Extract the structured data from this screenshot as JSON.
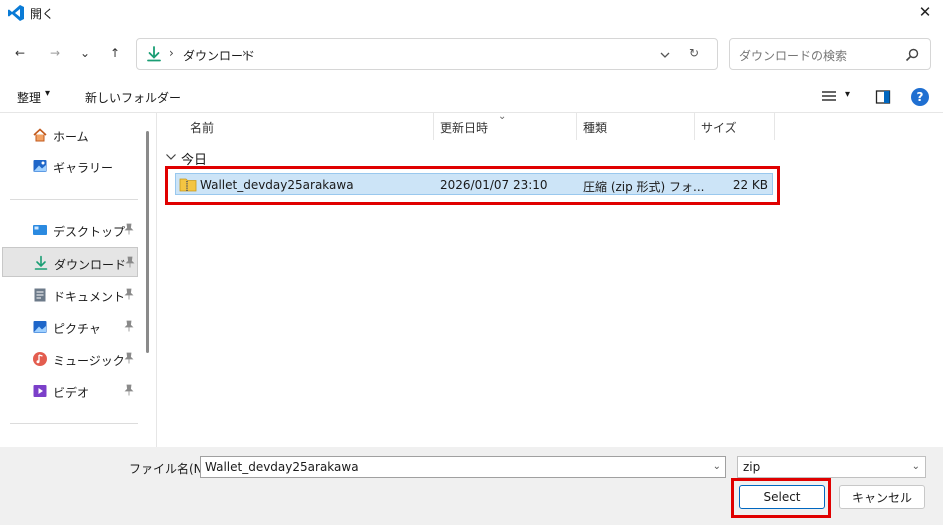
{
  "window": {
    "title": "開く",
    "close_glyph": "✕"
  },
  "navigation": {
    "back_glyph": "←",
    "forward_glyph": "→",
    "recent_glyph": "⌄",
    "up_glyph": "↑",
    "breadcrumb_separator": "›",
    "breadcrumb": [
      "ダウンロード"
    ],
    "refresh_glyph": "↻"
  },
  "search": {
    "placeholder": "ダウンロードの検索"
  },
  "commandbar": {
    "organize_label": "整理",
    "organize_caret": "▾",
    "new_folder_label": "新しいフォルダー",
    "view_caret": "▾",
    "help_glyph": "?"
  },
  "sidebar": {
    "items": [
      {
        "label": "ホーム",
        "icon": "home-icon",
        "pinned": false
      },
      {
        "label": "ギャラリー",
        "icon": "gallery-icon",
        "pinned": false
      },
      {
        "label": "デスクトップ",
        "icon": "desktop-icon",
        "pinned": true
      },
      {
        "label": "ダウンロード",
        "icon": "download-icon",
        "pinned": true,
        "selected": true
      },
      {
        "label": "ドキュメント",
        "icon": "document-icon",
        "pinned": true
      },
      {
        "label": "ピクチャ",
        "icon": "pictures-icon",
        "pinned": true
      },
      {
        "label": "ミュージック",
        "icon": "music-icon",
        "pinned": true
      },
      {
        "label": "ビデオ",
        "icon": "video-icon",
        "pinned": true
      }
    ]
  },
  "file_list": {
    "columns": [
      "名前",
      "更新日時",
      "種類",
      "サイズ"
    ],
    "sort_caret": "⌄",
    "group_label": "今日",
    "files": [
      {
        "name": "Wallet_devday25arakawa",
        "modified": "2026/01/07 23:10",
        "type": "圧縮 (zip 形式) フォ...",
        "size": "22 KB",
        "selected": true
      }
    ]
  },
  "footer": {
    "filename_label": "ファイル名(N):",
    "filename_value": "Wallet_devday25arakawa",
    "filetype_value": "zip",
    "dropdown_caret": "⌄",
    "select_button": "Select",
    "cancel_button": "キャンセル"
  },
  "colors": {
    "accent": "#0067c0",
    "highlight_annotation": "#e00000",
    "selection_fill": "#cce4f7"
  }
}
